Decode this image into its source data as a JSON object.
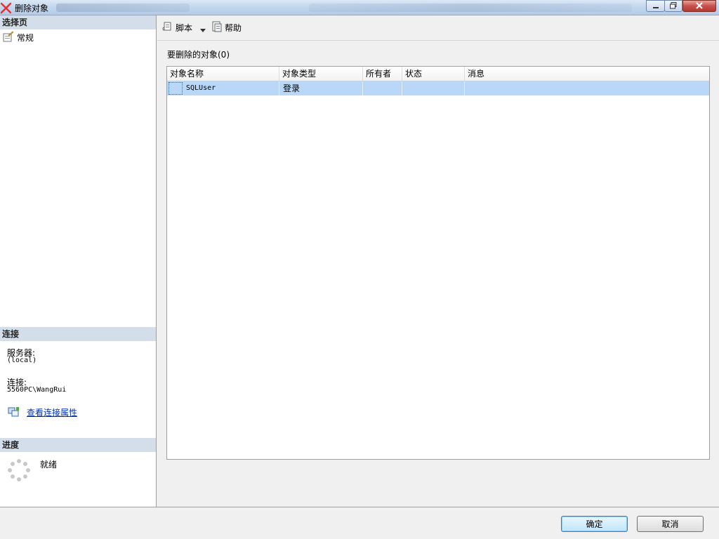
{
  "window": {
    "title": "删除对象",
    "controls": [
      "minimize-icon",
      "maximize-icon",
      "close-icon"
    ]
  },
  "left_panel": {
    "select_page": {
      "header": "选择页",
      "items": [
        {
          "label": "常规",
          "icon": "page-settings-icon"
        }
      ]
    },
    "connection": {
      "header": "连接",
      "server_label": "服务器:",
      "server_value": "(local)",
      "connection_label": "连接:",
      "connection_value": "5560PC\\WangRui",
      "view_properties_link": "查看连接属性"
    },
    "progress": {
      "header": "进度",
      "status": "就绪",
      "icon": "spinner-icon"
    }
  },
  "toolbar": {
    "script_label": "脚本",
    "help_label": "帮助"
  },
  "objects": {
    "caption": "要删除的对象(0)",
    "columns": [
      "对象名称",
      "对象类型",
      "所有者",
      "状态",
      "消息"
    ],
    "rows": [
      {
        "name": "SQLUser",
        "type": "登录",
        "owner": "",
        "status": "",
        "message": ""
      }
    ]
  },
  "buttons": {
    "ok": "确定",
    "cancel": "取消"
  },
  "colors": {
    "selection": "#b9d8f7",
    "section_header": "#d3deea",
    "link": "#0033aa",
    "title_bar": "#c2d6ee"
  }
}
